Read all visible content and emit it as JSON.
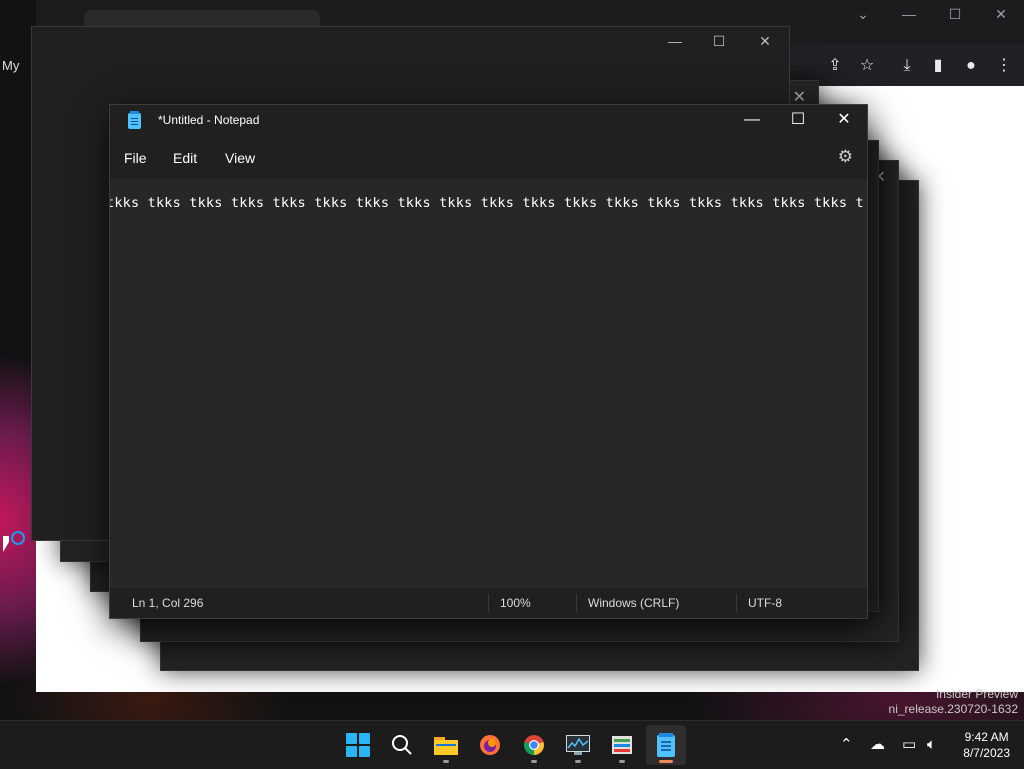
{
  "notepad": {
    "title": "*Untitled - Notepad",
    "menu": [
      "File",
      "Edit",
      "View"
    ],
    "text": "tkks tkks tkks tkks tkks tkks tkks tkks tkks tkks tkks tkks tkks tkks tkks tkks tkks tkks tkk",
    "status": {
      "position": "Ln 1, Col 296",
      "zoom": "100%",
      "line_endings": "Windows (CRLF)",
      "encoding": "UTF-8"
    },
    "controls": {
      "minimize": "—",
      "maximize": "☐",
      "close": "✕"
    }
  },
  "background": {
    "side_text": "My",
    "watermark_line1": "Insider Preview",
    "watermark_line2": "ni_release.230720-1632"
  },
  "taskbar": {
    "apps": [
      "start",
      "search",
      "file-explorer",
      "firefox",
      "chrome",
      "resource-monitor",
      "task-manager",
      "notepad"
    ],
    "clock_time": "9:42 AM",
    "clock_date": "8/7/2023"
  },
  "colors": {
    "accent": "#29b6f6",
    "active_indicator": "#f08a5d"
  }
}
